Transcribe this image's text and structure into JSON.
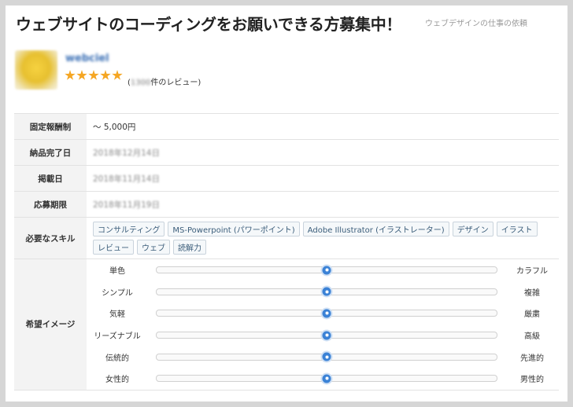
{
  "header": {
    "title": "ウェブサイトのコーディングをお願いできる方募集中！",
    "subtitle": "ウェブデザインの仕事の依頼"
  },
  "client": {
    "name": "webciel",
    "rating": 5,
    "review_prefix": "(",
    "review_count": "1300",
    "review_suffix": "件のレビュー)"
  },
  "details": {
    "reward": {
      "label": "固定報酬制",
      "value": "〜 5,000円"
    },
    "deadline": {
      "label": "納品完了日",
      "value": "2018年12月14日"
    },
    "posted": {
      "label": "掲載日",
      "value": "2018年11月14日"
    },
    "apply_by": {
      "label": "応募期限",
      "value": "2018年11月19日"
    },
    "skills_label": "必要なスキル",
    "image_label": "希望イメージ"
  },
  "skills": [
    "コンサルティング",
    "MS-Powerpoint (パワーポイント)",
    "Adobe Illustrator (イラストレーター)",
    "デザイン",
    "イラスト",
    "レビュー",
    "ウェブ",
    "読解力"
  ],
  "image_scales": [
    {
      "left": "単色",
      "right": "カラフル",
      "value": 0.5
    },
    {
      "left": "シンプル",
      "right": "複雑",
      "value": 0.5
    },
    {
      "left": "気軽",
      "right": "厳粛",
      "value": 0.5
    },
    {
      "left": "リーズナブル",
      "right": "高級",
      "value": 0.5
    },
    {
      "left": "伝統的",
      "right": "先進的",
      "value": 0.5
    },
    {
      "left": "女性的",
      "right": "男性的",
      "value": 0.5
    }
  ]
}
